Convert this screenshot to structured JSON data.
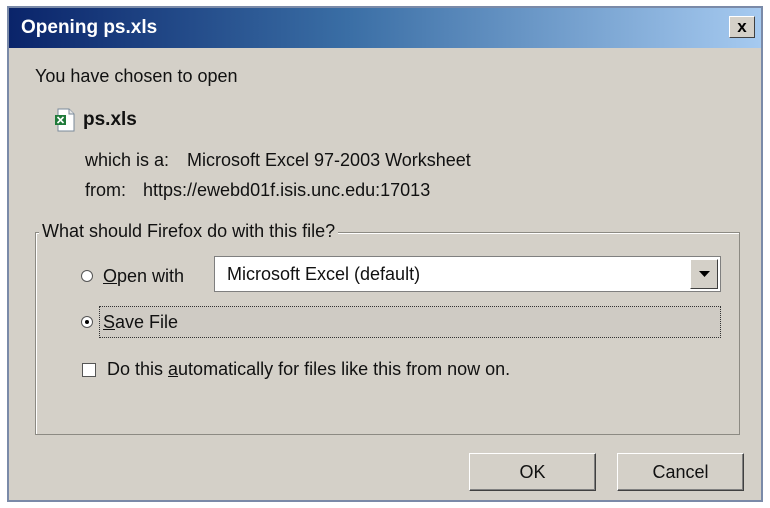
{
  "dialog": {
    "title": "Opening ps.xls",
    "close_label": "x"
  },
  "intro": "You have chosen to open",
  "file": {
    "name": "ps.xls",
    "type_label": "which is a:",
    "type_value": "Microsoft Excel 97-2003 Worksheet",
    "from_label": "from:",
    "from_value": "https://ewebd01f.isis.unc.edu:17013",
    "icon": "excel-file-icon"
  },
  "options": {
    "legend": "What should Firefox do with this file?",
    "open_with": {
      "prefix": "",
      "accel": "O",
      "rest": "pen with",
      "selected": false,
      "app": "Microsoft Excel (default)"
    },
    "save_file": {
      "accel": "S",
      "rest": "ave File",
      "selected": true
    },
    "auto": {
      "pre": "Do this ",
      "accel": "a",
      "post": "utomatically for files like this from now on.",
      "checked": false
    }
  },
  "buttons": {
    "ok": "OK",
    "cancel": "Cancel"
  },
  "colors": {
    "title_start": "#0a246a",
    "title_end": "#a6caf0",
    "face": "#d4d0c8"
  }
}
